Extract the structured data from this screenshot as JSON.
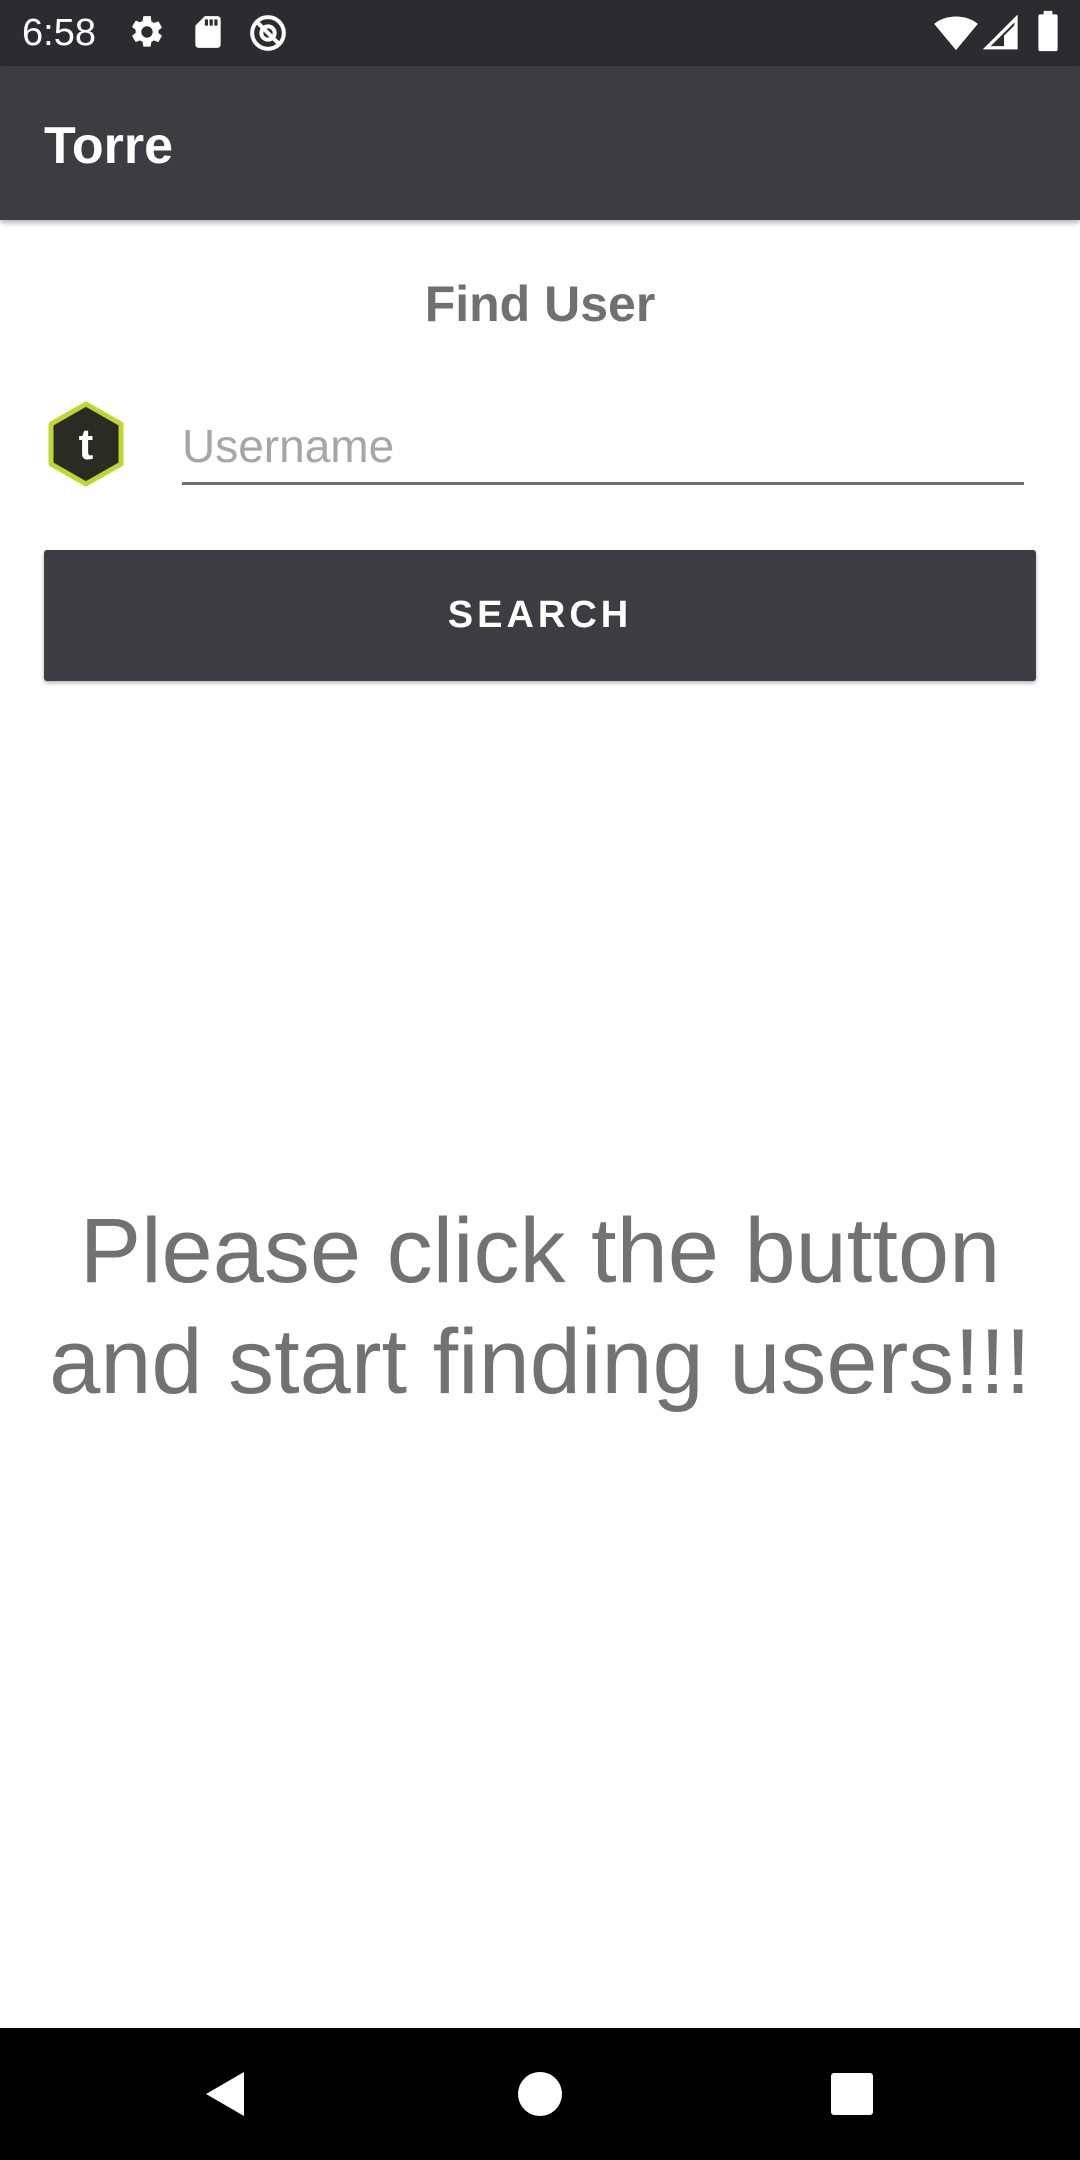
{
  "status_bar": {
    "time": "6:58",
    "left_icons": [
      "gear-icon",
      "sd-card-icon",
      "at-sign-icon"
    ],
    "right_icons": [
      "wifi-icon",
      "signal-icon",
      "battery-icon"
    ]
  },
  "app_bar": {
    "title": "Torre"
  },
  "main": {
    "section_title": "Find User",
    "logo_letter": "t",
    "username_placeholder": "Username",
    "username_value": "",
    "search_label": "SEARCH",
    "empty_message": "Please click the button and start finding users!!!"
  },
  "nav_bar": {
    "icons": [
      "back-icon",
      "home-icon",
      "recents-icon"
    ]
  },
  "colors": {
    "status_bar": "#2b2c30",
    "app_bar": "#3b3d42",
    "button": "#3b3d42",
    "logo_fill": "#2a2b22",
    "logo_border": "#c2d633",
    "muted_text": "#727272"
  }
}
